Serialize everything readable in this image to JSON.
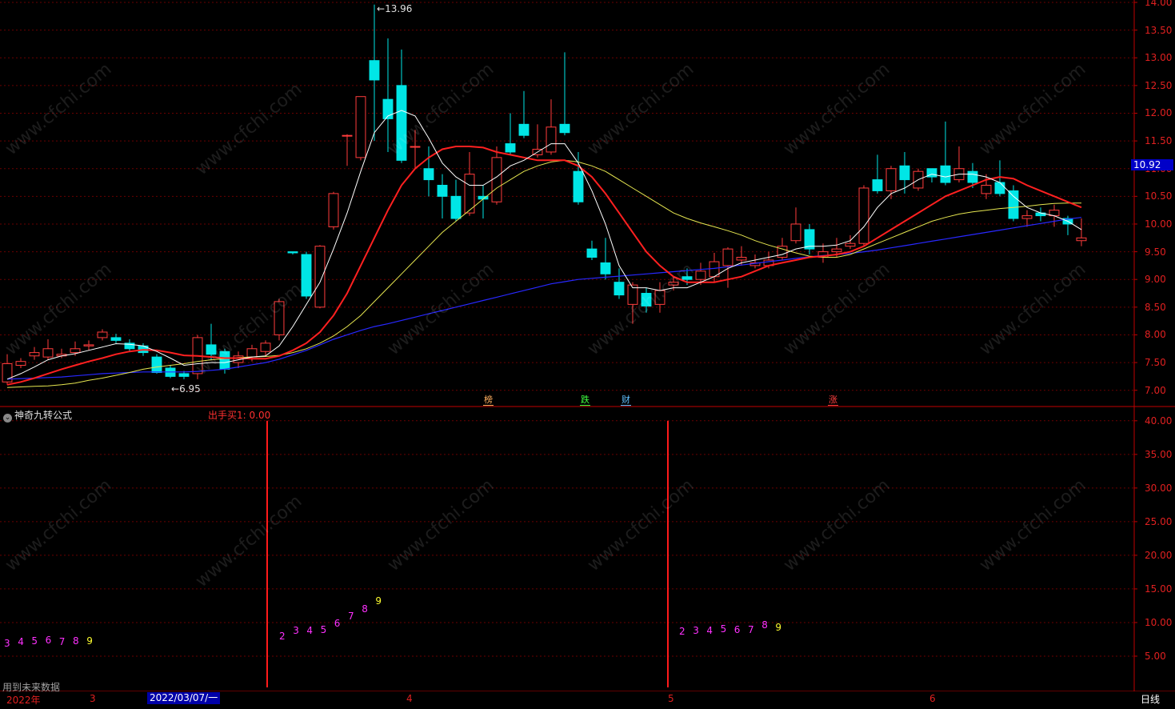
{
  "app": {
    "chart_type": "candlestick",
    "period_label": "日线"
  },
  "price_axis": {
    "ticks": [
      "14.00",
      "13.50",
      "13.00",
      "12.50",
      "12.00",
      "11.50",
      "11.00",
      "10.50",
      "10.00",
      "9.50",
      "9.00",
      "8.50",
      "8.00",
      "7.50",
      "7.00"
    ],
    "min": 6.75,
    "max": 14.0,
    "current_price": "10.92",
    "high_note": "13.96",
    "low_note": "6.95"
  },
  "indicator_axis": {
    "ticks": [
      "40.00",
      "35.00",
      "30.00",
      "25.00",
      "20.00",
      "15.00",
      "10.00",
      "5.00"
    ],
    "max": 42.0
  },
  "markers": [
    {
      "text": "榜",
      "color": "#ffb060"
    },
    {
      "text": "跌",
      "color": "#40ff40"
    },
    {
      "text": "财",
      "color": "#60c0ff"
    },
    {
      "text": "涨",
      "color": "#ff4040"
    }
  ],
  "indicator": {
    "name": "神奇九转公式",
    "buy_label": "出手买1: 0.00",
    "future_note": "用到未来数据",
    "buy_signals": [
      40,
      40
    ],
    "count_sequences": [
      {
        "counts": [
          "3",
          "4",
          "5",
          "6",
          "7",
          "8",
          "9"
        ]
      },
      {
        "counts": [
          "2",
          "3",
          "4",
          "5",
          "6",
          "7",
          "8",
          "9"
        ]
      },
      {
        "counts": [
          "2",
          "3",
          "4",
          "5",
          "6",
          "7",
          "8",
          "9"
        ]
      }
    ]
  },
  "time_axis": {
    "labels": [
      "2022年",
      "3",
      "4",
      "5",
      "6"
    ],
    "cursor_date": "2022/03/07/一"
  },
  "watermark": "www.cfchi.com",
  "colors": {
    "up": "#ff3c3c",
    "down": "#00e6e6",
    "ma5": "#ffffff",
    "ma10": "#ff2020",
    "ma20": "#e6e650",
    "ma60": "#2828ff",
    "grid": "#6a0000",
    "axis": "#c00000"
  },
  "chart_data": {
    "type": "candlestick",
    "x": [
      1,
      2,
      3,
      4,
      5,
      6,
      7,
      8,
      9,
      10,
      11,
      12,
      13,
      14,
      15,
      16,
      17,
      18,
      19,
      20,
      21,
      22,
      23,
      24,
      25,
      26,
      27,
      28,
      29,
      30,
      31,
      32,
      33,
      34,
      35,
      36,
      37,
      38,
      39,
      40,
      41,
      42,
      43,
      44,
      45,
      46,
      47,
      48,
      49,
      50,
      51,
      52,
      53,
      54,
      55,
      56,
      57,
      58,
      59,
      60,
      61,
      62,
      63,
      64,
      65,
      66,
      67,
      68,
      69,
      70,
      71,
      72,
      73,
      74,
      75,
      76,
      77,
      78,
      79,
      80
    ],
    "candles": [
      [
        7.15,
        7.48,
        7.65,
        7.1
      ],
      [
        7.45,
        7.52,
        7.58,
        7.4
      ],
      [
        7.62,
        7.68,
        7.78,
        7.55
      ],
      [
        7.6,
        7.75,
        7.92,
        7.55
      ],
      [
        7.62,
        7.65,
        7.75,
        7.58
      ],
      [
        7.68,
        7.75,
        7.88,
        7.62
      ],
      [
        7.8,
        7.82,
        7.9,
        7.72
      ],
      [
        7.95,
        8.05,
        8.1,
        7.9
      ],
      [
        7.95,
        7.9,
        8.02,
        7.85
      ],
      [
        7.85,
        7.75,
        7.92,
        7.7
      ],
      [
        7.8,
        7.68,
        7.85,
        7.62
      ],
      [
        7.6,
        7.32,
        7.65,
        7.3
      ],
      [
        7.4,
        7.25,
        7.45,
        7.22
      ],
      [
        7.3,
        7.25,
        7.35,
        7.2
      ],
      [
        7.3,
        7.95,
        8.0,
        7.2
      ],
      [
        7.82,
        7.65,
        8.2,
        7.55
      ],
      [
        7.7,
        7.38,
        7.75,
        7.3
      ],
      [
        7.5,
        7.62,
        7.7,
        7.4
      ],
      [
        7.6,
        7.75,
        7.82,
        7.52
      ],
      [
        7.7,
        7.85,
        7.9,
        7.62
      ],
      [
        8.0,
        8.6,
        8.65,
        7.9
      ],
      [
        9.5,
        9.48,
        9.5,
        9.45
      ],
      [
        9.45,
        8.7,
        9.5,
        8.65
      ],
      [
        8.5,
        9.6,
        9.62,
        8.48
      ],
      [
        9.95,
        10.55,
        10.58,
        9.9
      ],
      [
        11.6,
        11.6,
        11.62,
        11.05
      ],
      [
        11.2,
        12.3,
        12.3,
        11.15
      ],
      [
        12.95,
        12.6,
        13.96,
        11.5
      ],
      [
        12.25,
        11.9,
        13.35,
        11.3
      ],
      [
        12.5,
        11.15,
        13.15,
        11.1
      ],
      [
        11.4,
        11.4,
        11.7,
        11.0
      ],
      [
        11.0,
        10.8,
        11.4,
        10.5
      ],
      [
        10.7,
        10.5,
        10.9,
        10.1
      ],
      [
        10.5,
        10.1,
        10.8,
        10.05
      ],
      [
        10.2,
        10.9,
        11.3,
        10.15
      ],
      [
        10.5,
        10.45,
        10.7,
        10.1
      ],
      [
        10.4,
        11.2,
        11.4,
        10.35
      ],
      [
        11.45,
        11.3,
        12.0,
        11.25
      ],
      [
        11.8,
        11.6,
        12.4,
        11.55
      ],
      [
        11.25,
        11.35,
        11.8,
        11.2
      ],
      [
        11.3,
        11.75,
        12.25,
        11.25
      ],
      [
        11.8,
        11.65,
        13.1,
        11.6
      ],
      [
        10.95,
        10.4,
        11.3,
        10.35
      ],
      [
        9.55,
        9.4,
        9.7,
        9.35
      ],
      [
        9.3,
        9.1,
        9.75,
        9.0
      ],
      [
        8.95,
        8.72,
        9.2,
        8.65
      ],
      [
        8.55,
        8.9,
        8.95,
        8.2
      ],
      [
        8.75,
        8.52,
        8.85,
        8.4
      ],
      [
        8.55,
        8.8,
        8.95,
        8.4
      ],
      [
        8.9,
        8.95,
        9.05,
        8.8
      ],
      [
        9.05,
        9.0,
        9.2,
        8.9
      ],
      [
        9.0,
        9.15,
        9.3,
        8.9
      ],
      [
        9.05,
        9.32,
        9.48,
        8.95
      ],
      [
        9.25,
        9.55,
        9.58,
        8.85
      ],
      [
        9.35,
        9.4,
        9.6,
        9.25
      ],
      [
        9.25,
        9.3,
        9.45,
        9.2
      ],
      [
        9.25,
        9.35,
        9.5,
        9.2
      ],
      [
        9.4,
        9.6,
        9.75,
        9.35
      ],
      [
        9.7,
        10.0,
        10.3,
        9.65
      ],
      [
        9.9,
        9.55,
        10.0,
        9.45
      ],
      [
        9.4,
        9.5,
        9.65,
        9.3
      ],
      [
        9.5,
        9.55,
        9.75,
        9.4
      ],
      [
        9.6,
        9.65,
        9.8,
        9.55
      ],
      [
        9.65,
        10.65,
        10.7,
        9.6
      ],
      [
        10.8,
        10.6,
        11.25,
        10.55
      ],
      [
        10.6,
        11.0,
        11.05,
        10.45
      ],
      [
        11.05,
        10.8,
        11.3,
        10.55
      ],
      [
        10.65,
        10.95,
        11.0,
        10.6
      ],
      [
        11.0,
        10.85,
        11.0,
        10.75
      ],
      [
        11.05,
        10.75,
        11.85,
        10.7
      ],
      [
        10.8,
        11.0,
        11.4,
        10.75
      ],
      [
        10.95,
        10.75,
        11.1,
        10.65
      ],
      [
        10.55,
        10.7,
        10.9,
        10.45
      ],
      [
        10.75,
        10.55,
        11.15,
        10.5
      ],
      [
        10.6,
        10.1,
        10.7,
        10.05
      ],
      [
        10.1,
        10.15,
        10.25,
        9.95
      ],
      [
        10.2,
        10.15,
        10.3,
        10.05
      ],
      [
        10.15,
        10.25,
        10.35,
        9.95
      ],
      [
        10.1,
        10.0,
        10.15,
        9.8
      ],
      [
        9.7,
        9.75,
        10.1,
        9.6
      ]
    ],
    "ma5": [
      7.2,
      7.3,
      7.42,
      7.55,
      7.62,
      7.66,
      7.72,
      7.78,
      7.84,
      7.83,
      7.8,
      7.7,
      7.58,
      7.45,
      7.48,
      7.5,
      7.5,
      7.55,
      7.6,
      7.62,
      7.8,
      8.15,
      8.55,
      8.95,
      9.55,
      10.2,
      10.95,
      11.65,
      11.95,
      12.05,
      11.95,
      11.55,
      11.1,
      10.85,
      10.7,
      10.7,
      10.85,
      11.05,
      11.15,
      11.3,
      11.45,
      11.45,
      11.1,
      10.6,
      10.0,
      9.25,
      8.85,
      8.85,
      8.8,
      8.85,
      8.85,
      8.95,
      9.05,
      9.2,
      9.3,
      9.35,
      9.4,
      9.45,
      9.55,
      9.6,
      9.6,
      9.62,
      9.7,
      9.95,
      10.3,
      10.55,
      10.65,
      10.8,
      10.9,
      10.85,
      10.9,
      10.9,
      10.85,
      10.75,
      10.5,
      10.3,
      10.2,
      10.15,
      10.05,
      9.9
    ],
    "ma10": [
      7.1,
      7.15,
      7.22,
      7.3,
      7.38,
      7.45,
      7.52,
      7.58,
      7.65,
      7.7,
      7.73,
      7.72,
      7.68,
      7.63,
      7.62,
      7.6,
      7.58,
      7.58,
      7.57,
      7.57,
      7.62,
      7.72,
      7.85,
      8.05,
      8.35,
      8.75,
      9.25,
      9.75,
      10.25,
      10.7,
      11.0,
      11.2,
      11.35,
      11.4,
      11.4,
      11.38,
      11.3,
      11.25,
      11.2,
      11.15,
      11.15,
      11.15,
      11.05,
      10.85,
      10.55,
      10.2,
      9.85,
      9.5,
      9.25,
      9.05,
      8.95,
      8.95,
      8.95,
      9.0,
      9.05,
      9.15,
      9.25,
      9.3,
      9.35,
      9.4,
      9.42,
      9.45,
      9.5,
      9.6,
      9.75,
      9.9,
      10.05,
      10.2,
      10.35,
      10.5,
      10.6,
      10.7,
      10.8,
      10.85,
      10.82,
      10.7,
      10.6,
      10.5,
      10.4,
      10.3
    ],
    "ma20": [
      7.05,
      7.06,
      7.07,
      7.08,
      7.1,
      7.13,
      7.18,
      7.22,
      7.27,
      7.32,
      7.38,
      7.42,
      7.45,
      7.48,
      7.52,
      7.55,
      7.57,
      7.59,
      7.6,
      7.61,
      7.63,
      7.68,
      7.75,
      7.85,
      7.98,
      8.15,
      8.35,
      8.6,
      8.85,
      9.1,
      9.35,
      9.6,
      9.85,
      10.05,
      10.25,
      10.45,
      10.65,
      10.8,
      10.95,
      11.05,
      11.12,
      11.15,
      11.12,
      11.05,
      10.95,
      10.8,
      10.65,
      10.5,
      10.35,
      10.2,
      10.1,
      10.02,
      9.95,
      9.88,
      9.8,
      9.7,
      9.62,
      9.55,
      9.48,
      9.42,
      9.4,
      9.4,
      9.45,
      9.55,
      9.65,
      9.75,
      9.85,
      9.95,
      10.05,
      10.12,
      10.18,
      10.22,
      10.25,
      10.28,
      10.3,
      10.32,
      10.35,
      10.37,
      10.38,
      10.38
    ],
    "ma60": [
      7.2,
      7.21,
      7.22,
      7.23,
      7.24,
      7.26,
      7.28,
      7.3,
      7.31,
      7.32,
      7.33,
      7.33,
      7.33,
      7.33,
      7.34,
      7.36,
      7.38,
      7.42,
      7.46,
      7.5,
      7.56,
      7.64,
      7.72,
      7.82,
      7.92,
      8.0,
      8.08,
      8.15,
      8.2,
      8.26,
      8.32,
      8.38,
      8.44,
      8.5,
      8.56,
      8.62,
      8.68,
      8.74,
      8.8,
      8.86,
      8.92,
      8.96,
      9.0,
      9.02,
      9.04,
      9.06,
      9.08,
      9.1,
      9.12,
      9.14,
      9.16,
      9.18,
      9.2,
      9.23,
      9.26,
      9.29,
      9.32,
      9.35,
      9.38,
      9.41,
      9.43,
      9.45,
      9.47,
      9.5,
      9.53,
      9.57,
      9.61,
      9.65,
      9.69,
      9.73,
      9.77,
      9.81,
      9.85,
      9.89,
      9.93,
      9.97,
      10.01,
      10.05,
      10.09,
      10.12
    ]
  }
}
